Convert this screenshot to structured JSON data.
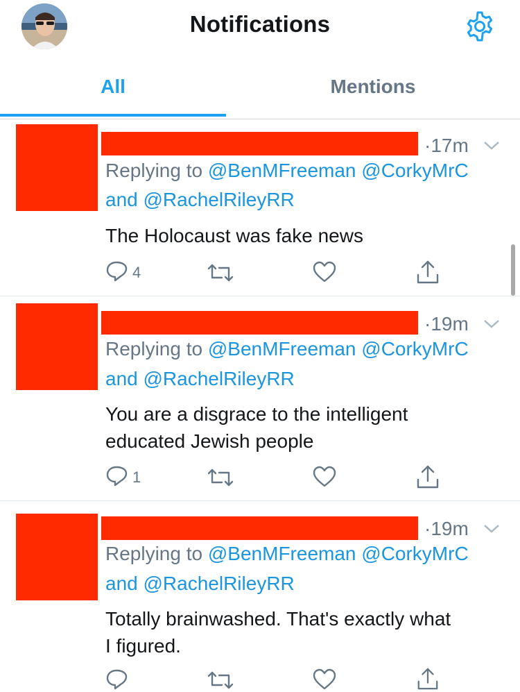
{
  "header": {
    "title": "Notifications"
  },
  "tabs": [
    {
      "label": "All",
      "active": true
    },
    {
      "label": "Mentions",
      "active": false
    }
  ],
  "colors": {
    "accent": "#1da1f2",
    "redaction": "#ff2a00",
    "muted": "#657786"
  },
  "notifications": [
    {
      "time": "·17m",
      "reply_prefix": "Replying to ",
      "mention_1": "@BenMFreeman",
      "mention_2": "@CorkyMrC",
      "reply_and": "and ",
      "mention_3": "@RachelRileyRR",
      "text": "The Holocaust was fake news",
      "reply_count": "4"
    },
    {
      "time": "·19m",
      "reply_prefix": "Replying to ",
      "mention_1": "@BenMFreeman",
      "mention_2": "@CorkyMrC",
      "reply_and": "and ",
      "mention_3": "@RachelRileyRR",
      "text_line_1": "You are a disgrace to the intelligent",
      "text_line_2": "educated Jewish people",
      "reply_count": "1"
    },
    {
      "time": "·19m",
      "reply_prefix": "Replying to ",
      "mention_1": "@BenMFreeman",
      "mention_2": "@CorkyMrC",
      "reply_and": "and ",
      "mention_3": "@RachelRileyRR",
      "text_line_1": "Totally brainwashed. That's exactly what",
      "text_line_2": "I figured.",
      "reply_count": ""
    }
  ],
  "icons": [
    "gear-icon",
    "reply-icon",
    "retweet-icon",
    "like-icon",
    "share-icon",
    "chevron-down-icon"
  ]
}
